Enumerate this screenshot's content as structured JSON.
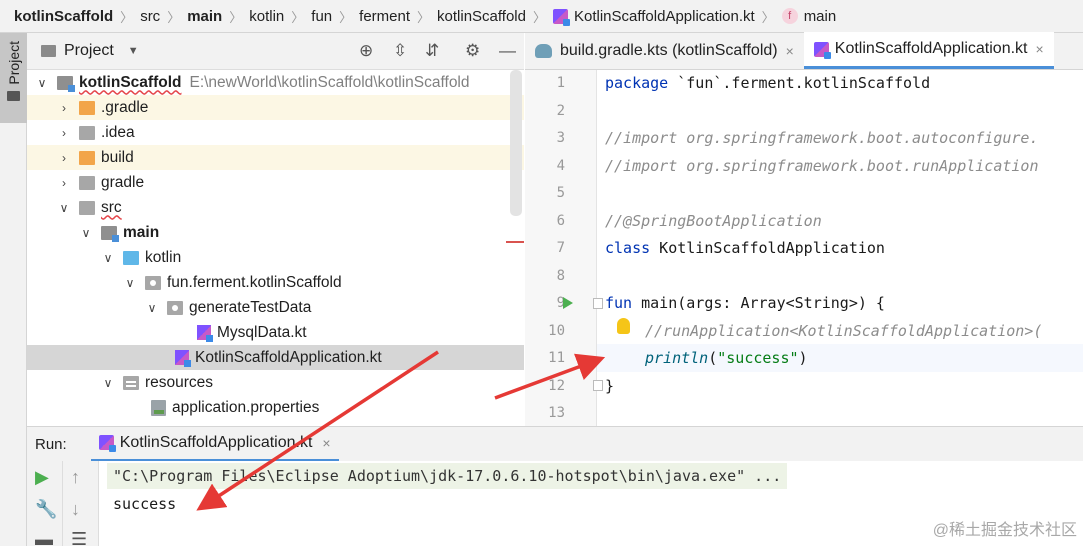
{
  "breadcrumbs": [
    "kotlinScaffold",
    "src",
    "main",
    "kotlin",
    "fun",
    "ferment",
    "kotlinScaffold",
    "KotlinScaffoldApplication.kt",
    "main"
  ],
  "fn_badge": "f",
  "left_strip": {
    "project_tab": "Project"
  },
  "project_panel": {
    "title": "Project"
  },
  "tree": [
    {
      "label": "kotlinScaffold",
      "path": "E:\\newWorld\\kotlinScaffold\\kotlinScaffold"
    },
    {
      "label": ".gradle"
    },
    {
      "label": ".idea"
    },
    {
      "label": "build"
    },
    {
      "label": "gradle"
    },
    {
      "label": "src"
    },
    {
      "label": "main"
    },
    {
      "label": "kotlin"
    },
    {
      "label": "fun.ferment.kotlinScaffold"
    },
    {
      "label": "generateTestData"
    },
    {
      "label": "MysqlData.kt"
    },
    {
      "label": "KotlinScaffoldApplication.kt"
    },
    {
      "label": "resources"
    },
    {
      "label": "application.properties"
    }
  ],
  "editor_tabs": [
    {
      "label": "build.gradle.kts (kotlinScaffold)",
      "close": "×"
    },
    {
      "label": "KotlinScaffoldApplication.kt",
      "close": "×"
    }
  ],
  "line_numbers": [
    "1",
    "2",
    "3",
    "4",
    "5",
    "6",
    "7",
    "8",
    "9",
    "10",
    "11",
    "12",
    "13"
  ],
  "code": {
    "l1_kw": "package",
    "l1_rest": " `fun`.ferment.kotlinScaffold",
    "l3": "//import org.springframework.boot.autoconfigure.",
    "l4": "//import org.springframework.boot.runApplication",
    "l6": "//@SpringBootApplication",
    "l7_kw": "class",
    "l7_rest": " KotlinScaffoldApplication",
    "l9_kw": "fun",
    "l9_rest": " main(args: Array<String>) {",
    "l10": "//runApplication<KotlinScaffoldApplication>(",
    "l11_fn": "println",
    "l11_open": "(",
    "l11_str": "\"success\"",
    "l11_close": ")",
    "l12": "}"
  },
  "run_panel": {
    "label": "Run:",
    "tab": "KotlinScaffoldApplication.kt",
    "close": "×",
    "command": "\"C:\\Program Files\\Eclipse Adoptium\\jdk-17.0.6.10-hotspot\\bin\\java.exe\" ...",
    "output": "success"
  },
  "watermark": "@稀土掘金技术社区",
  "colors": {
    "arrow": "#e53935",
    "accent": "#4a8fd8",
    "keyword": "#0033b3",
    "string": "#067d17"
  }
}
